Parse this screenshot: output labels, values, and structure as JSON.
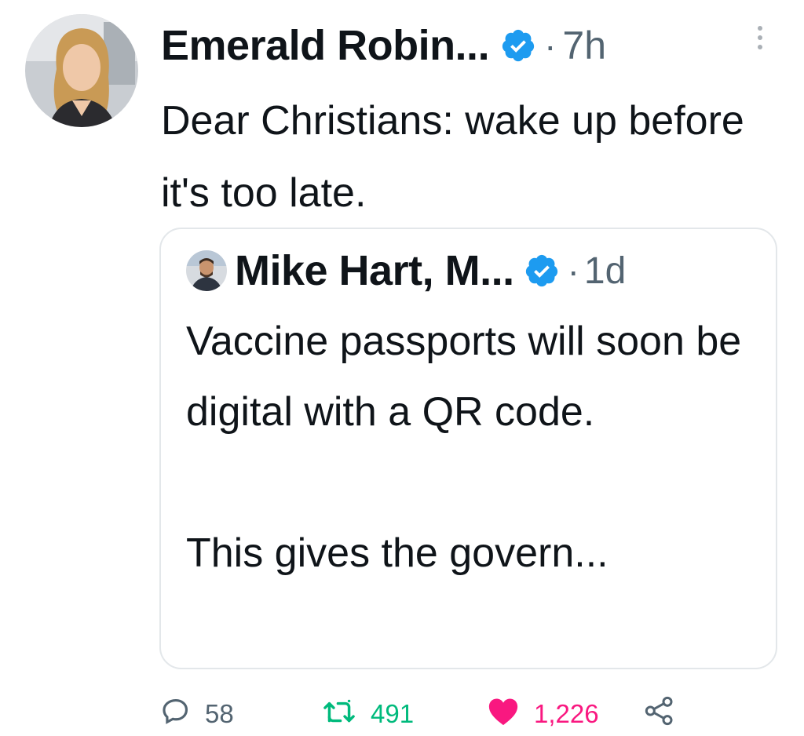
{
  "tweet": {
    "author_name": "Emerald Robin...",
    "separator": "·",
    "time": "7h",
    "text": "Dear Christians: wake up before it's too late.",
    "avatar_icon": "woman-portrait-avatar",
    "verified_icon": "verified-badge-icon",
    "more_icon": "vertical-ellipsis-icon"
  },
  "quote": {
    "author_name": "Mike Hart, M...",
    "separator": "·",
    "time": "1d",
    "text": "Vaccine passports will soon be digital with a QR code.\n\nThis gives the govern...",
    "avatar_icon": "man-portrait-avatar",
    "verified_icon": "verified-badge-icon"
  },
  "actions": {
    "reply_count": "58",
    "retweet_count": "491",
    "like_count": "1,226",
    "reply_icon": "speech-bubble-icon",
    "retweet_icon": "retweet-arrows-icon",
    "like_icon": "heart-icon",
    "share_icon": "share-nodes-icon"
  },
  "colors": {
    "verified_blue": "#1d9bf0",
    "muted_gray": "#536471",
    "retweet_green": "#00ba7c",
    "like_pink": "#f91880",
    "border": "#e3e7ea"
  }
}
